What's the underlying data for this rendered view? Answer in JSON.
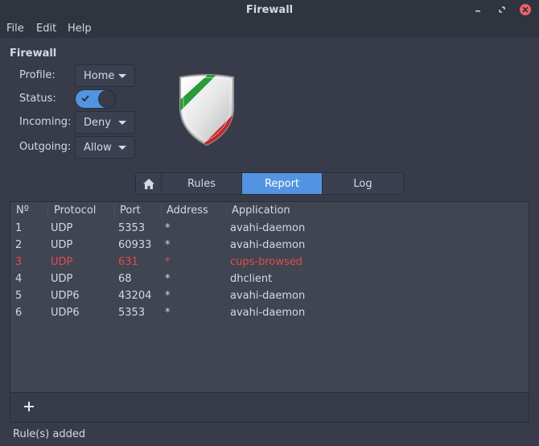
{
  "window": {
    "title": "Firewall"
  },
  "menubar": {
    "items": [
      "File",
      "Edit",
      "Help"
    ]
  },
  "firewall": {
    "section_title": "Firewall",
    "profile": {
      "label": "Profile:",
      "value": "Home"
    },
    "status": {
      "label": "Status:",
      "enabled": true
    },
    "incoming": {
      "label": "Incoming:",
      "value": "Deny"
    },
    "outgoing": {
      "label": "Outgoing:",
      "value": "Allow"
    }
  },
  "tabs": {
    "rules": "Rules",
    "report": "Report",
    "log": "Log",
    "active": "Report"
  },
  "table": {
    "columns": [
      "Nº",
      "Protocol",
      "Port",
      "Address",
      "Application"
    ],
    "rows": [
      {
        "no": "1",
        "protocol": "UDP",
        "port": "5353",
        "address": "*",
        "application": "avahi-daemon",
        "alert": false
      },
      {
        "no": "2",
        "protocol": "UDP",
        "port": "60933",
        "address": "*",
        "application": "avahi-daemon",
        "alert": false
      },
      {
        "no": "3",
        "protocol": "UDP",
        "port": "631",
        "address": "*",
        "application": "cups-browsed",
        "alert": true
      },
      {
        "no": "4",
        "protocol": "UDP",
        "port": "68",
        "address": "*",
        "application": "dhclient",
        "alert": false
      },
      {
        "no": "5",
        "protocol": "UDP6",
        "port": "43204",
        "address": "*",
        "application": "avahi-daemon",
        "alert": false
      },
      {
        "no": "6",
        "protocol": "UDP6",
        "port": "5353",
        "address": "*",
        "application": "avahi-daemon",
        "alert": false
      }
    ]
  },
  "status_bar": {
    "text": "Rule(s) added"
  },
  "colors": {
    "accent": "#5294e2",
    "alert": "#e34b4b",
    "background": "#383c4a",
    "close": "#f46067"
  }
}
